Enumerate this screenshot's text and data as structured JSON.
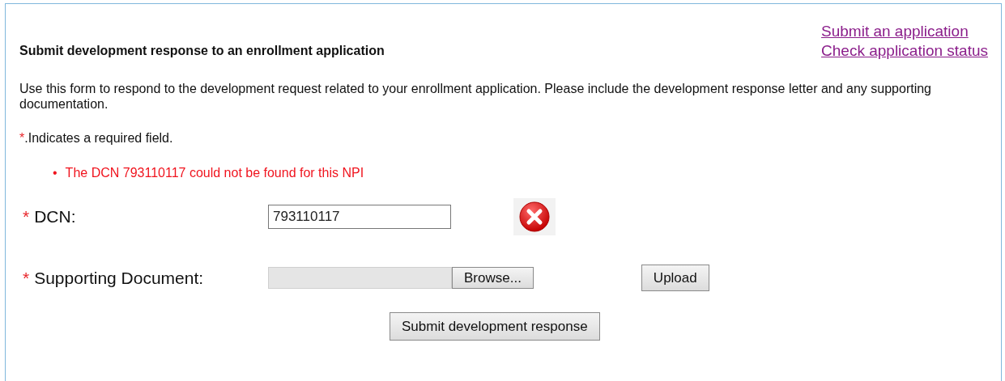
{
  "title": "Submit development response to an enrollment application",
  "links": [
    "Submit an application",
    "Check application status"
  ],
  "description": "Use this form to respond to the development request related to your enrollment application. Please include the development response letter and any supporting documentation.",
  "required_note": {
    "mark": "*",
    "text": ".Indicates a required field."
  },
  "errors": [
    {
      "bullet": "•",
      "text": "The DCN 793110117 could not be found for this NPI"
    }
  ],
  "fields": [
    {
      "kind": "text",
      "required_mark": "*",
      "label": "DCN:",
      "value": "793110117",
      "invalid": true
    },
    {
      "kind": "file",
      "required_mark": "*",
      "label": "Supporting Document:",
      "browse": "Browse...",
      "upload": "Upload"
    }
  ],
  "submit": "Submit development response"
}
